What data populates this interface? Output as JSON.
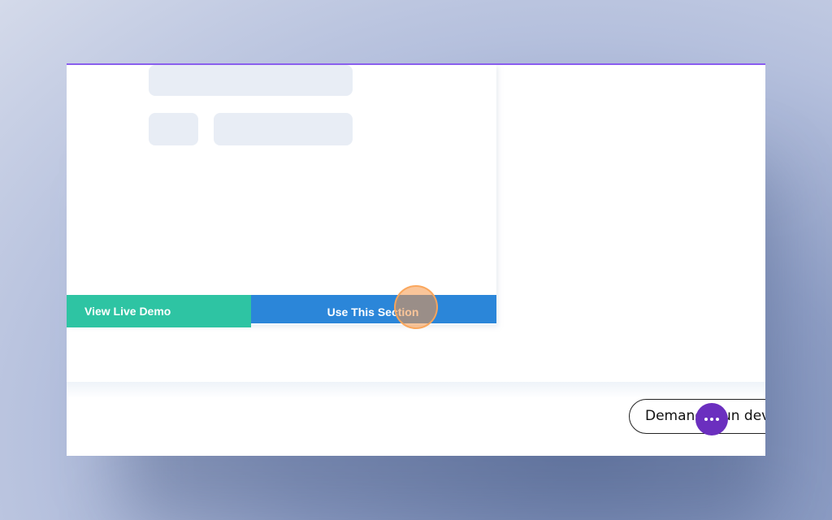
{
  "preview": {
    "view_demo_label": "View Live Demo",
    "use_section_label": "Use This Section"
  },
  "footer": {
    "demand_label": "Demander un devis"
  },
  "colors": {
    "accent_top": "#8a5cf0",
    "view_demo_bg": "#2ec4a3",
    "use_section_bg": "#2b86d9",
    "chat_bubble_bg": "#6b2fbf",
    "skeleton": "#e8edf5"
  },
  "icons": {
    "chat": "more-dots-icon"
  }
}
